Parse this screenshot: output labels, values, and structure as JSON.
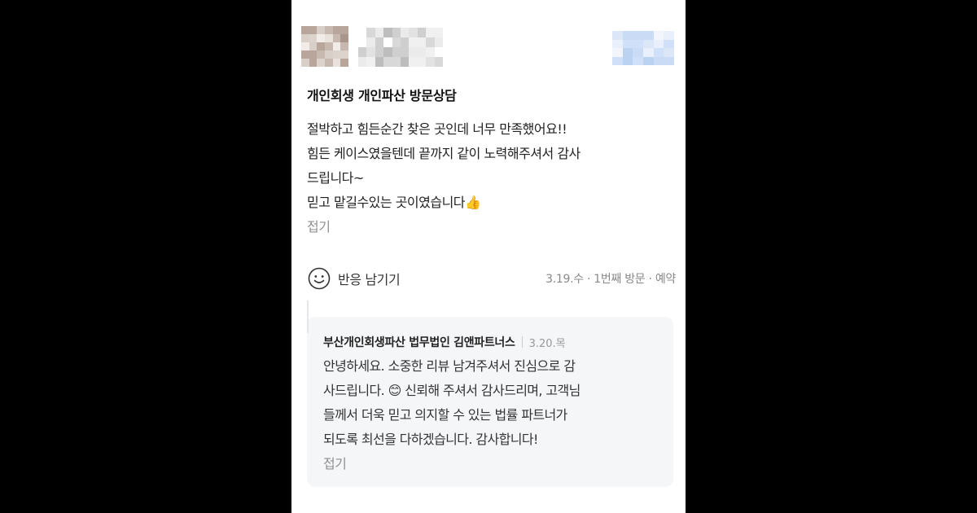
{
  "review": {
    "title": "개인회생 개인파산 방문상담",
    "body_lines": [
      "절박하고 힘든순간 찾은 곳인데 너무 만족했어요!!",
      "힘든 케이스였을텐데 끝까지 같이 노력해주셔서 감사",
      "드립니다~",
      "믿고 맡길수있는 곳이였습니다👍"
    ],
    "fold_label": "접기",
    "reaction_label": "반응 남기기",
    "meta": "3.19.수 · 1번째 방문 · 예약"
  },
  "reply": {
    "owner": "부산개인회생파산 법무법인 김앤파트너스",
    "date": "3.20.목",
    "lines": [
      "안녕하세요. 소중한 리뷰 남겨주셔서 진심으로 감",
      "사드립니다. 😊 신뢰해 주셔서 감사드리며, 고객님",
      "들께서 더욱 믿고 의지할 수 있는 법률 파트너가",
      "되도록 최선을 다하겠습니다. 감사합니다!"
    ],
    "fold_label": "접기"
  },
  "colors": {
    "page_bg": "#ffffff",
    "backdrop": "#000000",
    "reply_bg": "#f5f6f8",
    "muted": "#8f8f8f"
  }
}
